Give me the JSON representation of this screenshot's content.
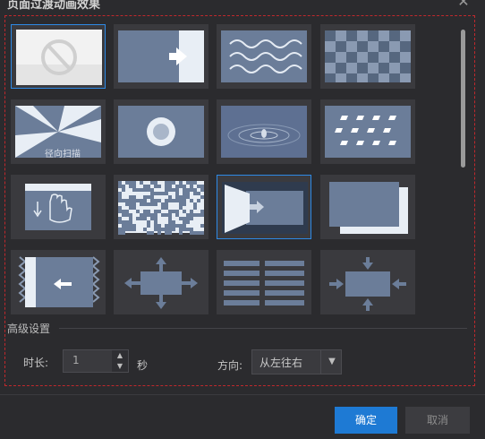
{
  "dialog": {
    "title": "页面过渡动画效果",
    "close_icon": "close-icon"
  },
  "effects": [
    {
      "icon": "none-icon",
      "selected": true
    },
    {
      "icon": "push-right-icon",
      "selected": false
    },
    {
      "icon": "wave-icon",
      "selected": false
    },
    {
      "icon": "checkerboard-icon",
      "selected": false
    },
    {
      "icon": "radial-wipe-icon",
      "selected": false,
      "overlay_text": "径向扫描"
    },
    {
      "icon": "circle-zoom-icon",
      "selected": false
    },
    {
      "icon": "ripple-icon",
      "selected": false
    },
    {
      "icon": "dots-icon",
      "selected": false
    },
    {
      "icon": "page-curl-icon",
      "selected": false
    },
    {
      "icon": "dissolve-icon",
      "selected": false
    },
    {
      "icon": "door-open-icon",
      "selected": true
    },
    {
      "icon": "stacked-pages-icon",
      "selected": false
    },
    {
      "icon": "zigzag-slide-left-icon",
      "selected": false
    },
    {
      "icon": "expand-all-directions-icon",
      "selected": false
    },
    {
      "icon": "horizontal-blinds-icon",
      "selected": false
    },
    {
      "icon": "contract-center-icon",
      "selected": false
    }
  ],
  "advanced": {
    "section_title": "高级设置",
    "duration_label": "时长:",
    "duration_value": "1",
    "duration_unit": "秒",
    "direction_label": "方向:",
    "direction_value": "从左往右"
  },
  "buttons": {
    "ok": "确定",
    "cancel": "取消"
  },
  "colors": {
    "accent": "#1e7ad4",
    "selection_border": "#2e8ae6",
    "thumb_fill": "#6b7d99",
    "background": "#2b2b2e"
  }
}
